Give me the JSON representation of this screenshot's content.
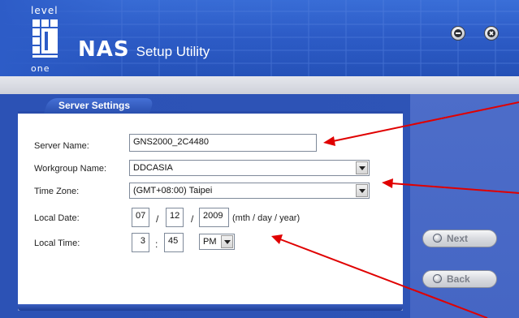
{
  "logo": {
    "top_text": "level",
    "bottom_text": "one"
  },
  "app_title": {
    "brand": "NAS",
    "rest": "Setup Utility"
  },
  "window_controls": {
    "minimize_icon": "minus-circle-icon",
    "close_icon": "x-circle-icon"
  },
  "tab": {
    "label": "Server Settings"
  },
  "form": {
    "server_name": {
      "label": "Server Name:",
      "value": "GNS2000_2C4480"
    },
    "workgroup_name": {
      "label": "Workgroup Name:",
      "value": "DDCASIA"
    },
    "time_zone": {
      "label": "Time Zone:",
      "value": "(GMT+08:00) Taipei"
    },
    "local_date": {
      "label": "Local Date:",
      "month": "07",
      "day": "12",
      "year": "2009",
      "separator": "/",
      "hint": "(mth / day / year)"
    },
    "local_time": {
      "label": "Local Time:",
      "hour": "3",
      "minute": "45",
      "separator": ":",
      "ampm": "PM"
    }
  },
  "nav": {
    "next_label": "Next",
    "back_label": "Back"
  },
  "colors": {
    "header_blue": "#2d5cc7",
    "sidebar_blue": "#4566c4",
    "annotation_arrow": "#e00000"
  }
}
